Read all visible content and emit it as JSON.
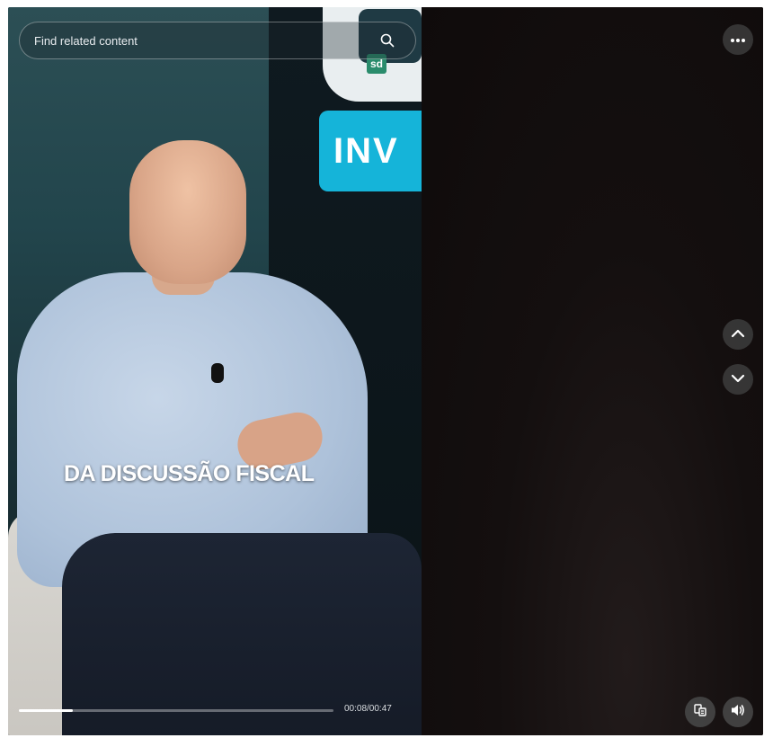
{
  "search": {
    "placeholder": "Find related content"
  },
  "video": {
    "logo_text": "sd",
    "badge_text": "INV",
    "caption": "DA DISCUSSÃO FISCAL"
  },
  "player": {
    "current_time": "00:08",
    "duration": "00:47",
    "time_display": "00:08/00:47",
    "progress_percent": 17
  },
  "icons": {
    "more": "more-horizontal-icon",
    "up": "chevron-up-icon",
    "down": "chevron-down-icon",
    "captions": "captions-icon",
    "volume": "volume-icon",
    "search": "search-icon"
  },
  "colors": {
    "badge": "#15b4d9",
    "dark_panel": "#120d0d"
  }
}
